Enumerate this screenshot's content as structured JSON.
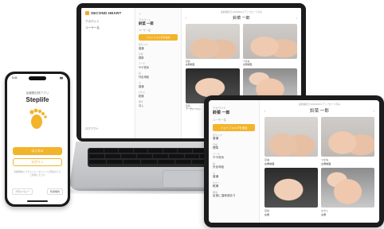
{
  "phone": {
    "time": "9:41",
    "subtitle": "足観察記録アプリ",
    "app_name": "Steplife",
    "primary_button": "はじめる",
    "secondary_button": "ログイン",
    "note": "利用規約とプライバシーポリシーに同意のうえご利用ください",
    "footer_left": "プライバシー",
    "footer_right": "利用規約"
  },
  "laptop": {
    "brand": "SECOND HEART",
    "sidebar": [
      "アカウント",
      "ユーザー名"
    ],
    "sidebar_bottom": "ログアウト",
    "detail": {
      "back": "←",
      "label": "アカウント",
      "name": "鈴菜 一郎",
      "sub_label": "ユーザー名",
      "button": "フォトフォルダを追加",
      "fields": [
        {
          "k": "足サイズ",
          "v": "普通"
        },
        {
          "k": "足幅",
          "v": "標準"
        },
        {
          "k": "アーチ",
          "v": "やや低め"
        },
        {
          "k": "指",
          "v": "外反母趾"
        },
        {
          "k": "爪",
          "v": "普通"
        },
        {
          "k": "かかと",
          "v": "乾燥"
        },
        {
          "k": "備考",
          "v": "なし"
        }
      ]
    },
    "main": {
      "top_note": "最終撮影日 2023/06/13 アップロード済み",
      "title": "鈴菜 一郎",
      "prev": "‹",
      "next": "›",
      "photos": [
        {
          "caption": "足裏",
          "label": "右側前面"
        },
        {
          "caption": "つま先",
          "label": "左側前面"
        },
        {
          "caption": "足指",
          "label": "アーチ(ソフト)"
        },
        {
          "caption": "かかと",
          "label": "右側"
        }
      ]
    }
  },
  "tablet": {
    "detail": {
      "label": "アカウント",
      "name": "鈴菜 一郎",
      "sub_label": "ユーザー名",
      "button": "フォトフォルダを追加",
      "fields": [
        {
          "k": "足サイズ",
          "v": "普通"
        },
        {
          "k": "足幅",
          "v": "標準"
        },
        {
          "k": "アーチ",
          "v": "やや低め"
        },
        {
          "k": "指",
          "v": "外反母趾"
        },
        {
          "k": "爪",
          "v": "普通"
        },
        {
          "k": "かかと",
          "v": "乾燥"
        },
        {
          "k": "備考",
          "v": "足首に違和感あり"
        }
      ]
    },
    "main": {
      "top_note": "最終撮影日 2023/06/13 アップロード済み",
      "title": "鈴菜 一郎",
      "prev": "‹",
      "next": "›",
      "photos": [
        {
          "caption": "足裏",
          "label": "右側前面"
        },
        {
          "caption": "つま先",
          "label": "左側前面"
        },
        {
          "caption": "足指",
          "label": "右側"
        },
        {
          "caption": "かかと",
          "label": "左側"
        }
      ]
    }
  },
  "colors": {
    "accent": "#f2b42b",
    "device": "#1c1c1e"
  }
}
